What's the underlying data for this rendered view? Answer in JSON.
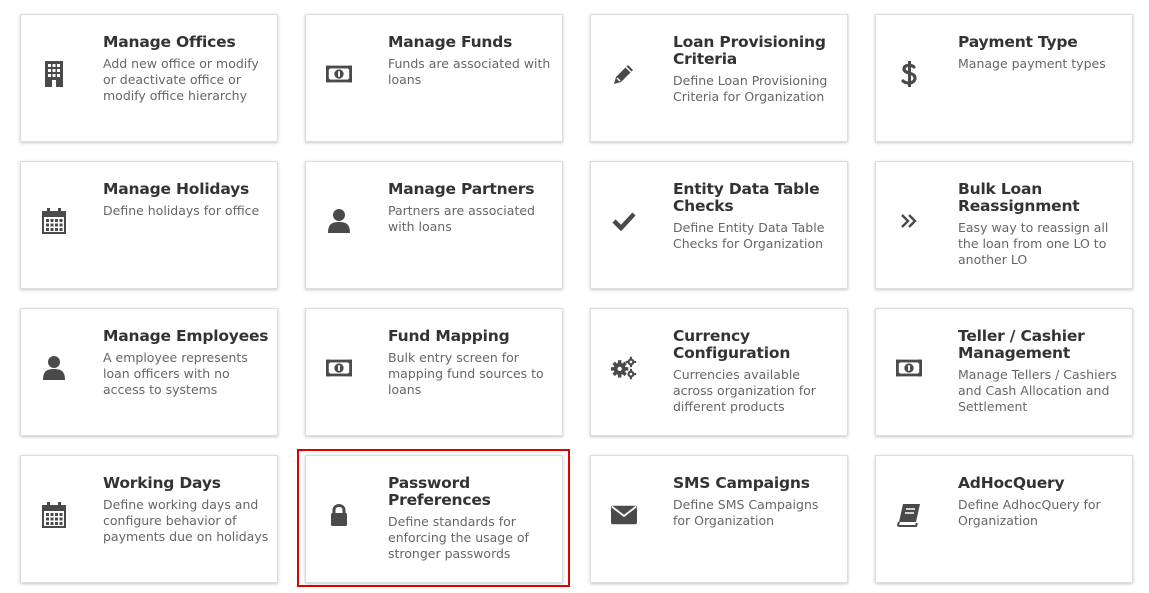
{
  "colors": {
    "icon": "#4a4a4a",
    "title": "#333333",
    "description": "#666666",
    "highlight_border": "#e10000"
  },
  "cards": [
    {
      "title": "Manage Offices",
      "description": "Add new office or modify or deactivate office or modify office hierarchy",
      "icon": "building-icon"
    },
    {
      "title": "Manage Funds",
      "description": "Funds are associated with loans",
      "icon": "money-icon"
    },
    {
      "title": "Loan Provisioning Criteria",
      "description": "Define Loan Provisioning Criteria for Organization",
      "icon": "pencil-icon"
    },
    {
      "title": "Payment Type",
      "description": "Manage payment types",
      "icon": "dollar-icon"
    },
    {
      "title": "Manage Holidays",
      "description": "Define holidays for office",
      "icon": "calendar-icon"
    },
    {
      "title": "Manage Partners",
      "description": "Partners are associated with loans",
      "icon": "user-icon"
    },
    {
      "title": "Entity Data Table Checks",
      "description": "Define Entity Data Table Checks for Organization",
      "icon": "check-icon"
    },
    {
      "title": "Bulk Loan Reassignment",
      "description": "Easy way to reassign all the loan from one LO to another LO",
      "icon": "double-chevron-right-icon"
    },
    {
      "title": "Manage Employees",
      "description": "A employee represents loan officers with no access to systems",
      "icon": "user-icon"
    },
    {
      "title": "Fund Mapping",
      "description": "Bulk entry screen for mapping fund sources to loans",
      "icon": "money-icon"
    },
    {
      "title": "Currency Configuration",
      "description": "Currencies available across organization for different products",
      "icon": "gears-icon"
    },
    {
      "title": "Teller / Cashier Management",
      "description": "Manage Tellers / Cashiers and Cash Allocation and Settlement",
      "icon": "money-icon"
    },
    {
      "title": "Working Days",
      "description": "Define working days and configure behavior of payments due on holidays",
      "icon": "calendar-icon"
    },
    {
      "title": "Password Preferences",
      "description": "Define standards for enforcing the usage of stronger passwords",
      "icon": "lock-icon"
    },
    {
      "title": "SMS Campaigns",
      "description": "Define SMS Campaigns for Organization",
      "icon": "envelope-icon"
    },
    {
      "title": "AdHocQuery",
      "description": "Define AdhocQuery for Organization",
      "icon": "book-icon"
    }
  ]
}
